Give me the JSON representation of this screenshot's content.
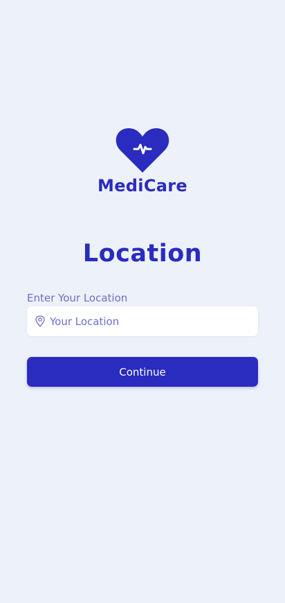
{
  "app": {
    "brand_name": "MediCare",
    "logo_icon": "heart-pulse-icon"
  },
  "page": {
    "title": "Location"
  },
  "location_field": {
    "label": "Enter Your Location",
    "placeholder": "Your Location",
    "value": "",
    "icon": "map-pin-icon"
  },
  "actions": {
    "continue_label": "Continue"
  },
  "colors": {
    "primary": "#2a2bbf",
    "background": "#edf1f9",
    "muted_text": "#6b6ec8",
    "input_background": "#ffffff"
  }
}
